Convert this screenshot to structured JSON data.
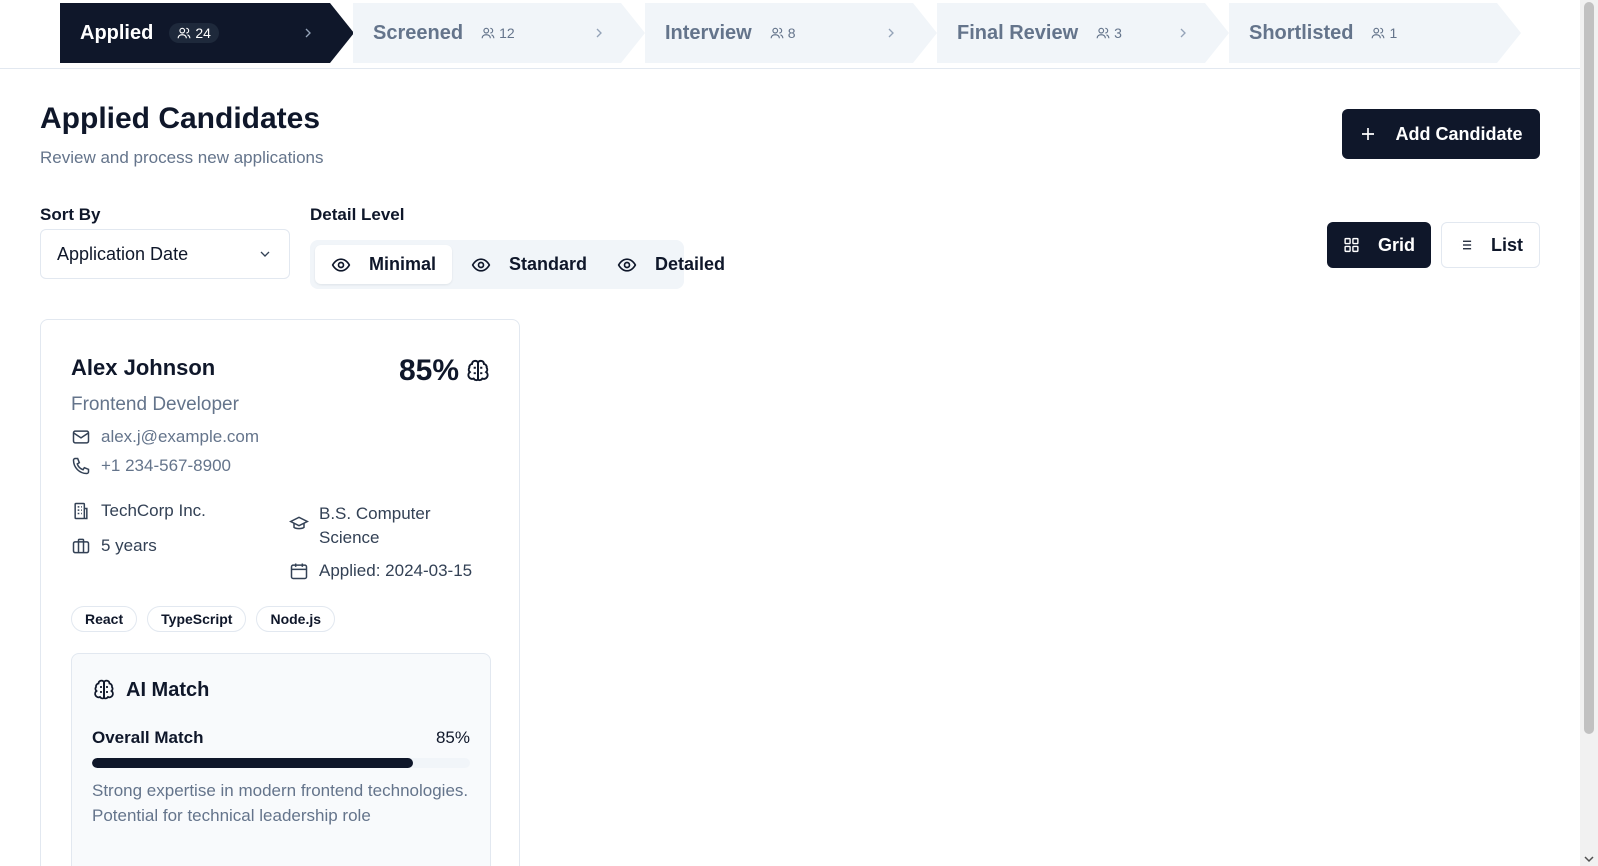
{
  "pipeline": {
    "stages": [
      {
        "name": "Applied",
        "count": "24"
      },
      {
        "name": "Screened",
        "count": "12"
      },
      {
        "name": "Interview",
        "count": "8"
      },
      {
        "name": "Final Review",
        "count": "3"
      },
      {
        "name": "Shortlisted",
        "count": "1"
      }
    ],
    "active_stage": "Applied"
  },
  "header": {
    "title": "Applied Candidates",
    "subtitle": "Review and process new applications",
    "add_button": "Add Candidate"
  },
  "controls": {
    "sort_label": "Sort By",
    "sort_value": "Application Date",
    "detail_label": "Detail Level",
    "detail_options": [
      "Minimal",
      "Standard",
      "Detailed"
    ],
    "detail_selected": "Minimal",
    "view_options": [
      "Grid",
      "List"
    ],
    "view_selected": "Grid"
  },
  "candidate": {
    "name": "Alex Johnson",
    "role": "Frontend Developer",
    "score": "85%",
    "email": "alex.j@example.com",
    "phone": "+1 234-567-8900",
    "company": "TechCorp Inc.",
    "experience": "5 years",
    "education": "B.S. Computer Science",
    "applied": "Applied: 2024-03-15",
    "skills": [
      "React",
      "TypeScript",
      "Node.js"
    ],
    "ai": {
      "title": "AI Match",
      "overall_label": "Overall Match",
      "overall_value": "85%",
      "overall_fraction": 0.85,
      "description": "Strong expertise in modern frontend technologies. Potential for technical leadership role"
    }
  },
  "colors": {
    "primary": "#0f172a",
    "muted_text": "#64748b",
    "border": "#e2e8f0",
    "inactive_stage": "#f1f5f9"
  }
}
